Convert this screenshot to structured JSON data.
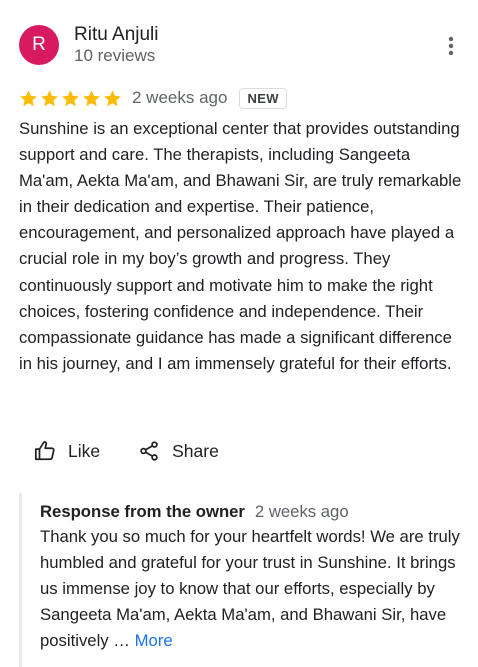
{
  "reviewer": {
    "initial": "R",
    "name": "Ritu Anjuli",
    "meta": "10 reviews",
    "avatar_color": "#d81b60"
  },
  "rating": {
    "stars": 5,
    "max_stars": 5,
    "star_color": "#fbbc04",
    "date": "2 weeks ago",
    "badge": "NEW"
  },
  "review": {
    "text": "Sunshine is an exceptional center that provides outstanding support and care. The therapists, including Sangeeta Ma'am, Aekta Ma'am, and Bhawani Sir, are truly remarkable in their dedication and expertise. Their patience, encouragement, and personalized approach have played a crucial role in my boy’s growth and progress. They continuously support and motivate him to make the right choices, fostering confidence and independence. Their compassionate guidance has made a significant difference in his journey, and I am immensely grateful for their efforts."
  },
  "actions": {
    "like_label": "Like",
    "like_icon": "thumb-up-outline-icon",
    "share_label": "Share",
    "share_icon": "share-icon"
  },
  "owner_response": {
    "title": "Response from the owner",
    "date": "2 weeks ago",
    "text": "Thank you so much for your heartfelt words! We are truly humbled and grateful for your trust in Sunshine. It brings us immense joy to know that our efforts, especially by Sangeeta Ma'am, Aekta Ma'am, and Bhawani Sir, have positively …",
    "more_label": "More",
    "accent_color": "#1a73e8"
  }
}
